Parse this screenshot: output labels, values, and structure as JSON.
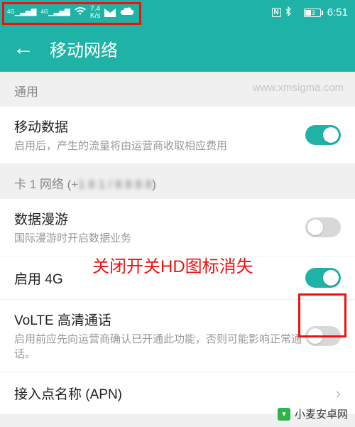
{
  "status": {
    "net1": "4G",
    "net2": "4G",
    "speed": "7.4",
    "speed_unit": "K/s",
    "nfc": "N",
    "battery": "43",
    "time": "6:51"
  },
  "header": {
    "title": "移动网络"
  },
  "sections": {
    "general_label": "通用",
    "sim1_label_prefix": "卡 1 网络 (+",
    "sim1_label_blur": "1 8 1 / 8 8 8 8",
    "sim1_label_suffix": ")"
  },
  "rows": {
    "mobile_data": {
      "title": "移动数据",
      "sub": "启用后，产生的流量将由运营商收取相应费用"
    },
    "roaming": {
      "title": "数据漫游",
      "sub": "国际漫游时开启数据业务"
    },
    "enable4g": {
      "title": "启用 4G"
    },
    "volte": {
      "title": "VoLTE 高清通话",
      "sub": "启用前应先向运营商确认已开通此功能，否则可能影响正常通话。"
    },
    "apn": {
      "title": "接入点名称 (APN)"
    }
  },
  "annotation": "关闭开关HD图标消失",
  "watermarks": {
    "top": "www.xmsigma.com",
    "bottom": "小麦安卓网"
  }
}
